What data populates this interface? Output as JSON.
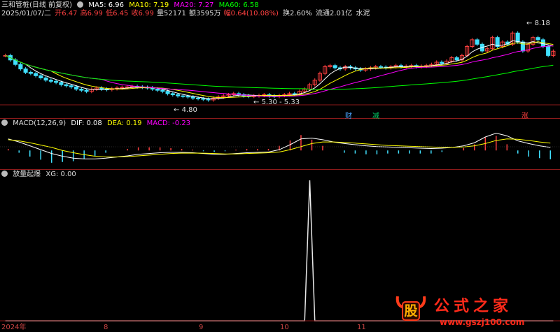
{
  "header1": {
    "stock_name": "三和管桩(日线 前复权)",
    "ma5": "MA5: 6.96",
    "ma10": "MA10: 7.19",
    "ma20": "MA20: 7.27",
    "ma60": "MA60: 6.58",
    "colors": {
      "ma5": "#ffffff",
      "ma10": "#ffff00",
      "ma20": "#ff00ff",
      "ma60": "#00ff00"
    }
  },
  "header2": {
    "date": "2025/01/07/二",
    "open": "开6.47",
    "high": "高6.99",
    "low": "低6.45",
    "close": "收6.99",
    "volume": "量52171",
    "amount": "额3595万",
    "change": "幅0.64(10.08%)",
    "turnover": "换2.60%",
    "float_cap": "流通2.01亿",
    "sector": "水泥"
  },
  "price_labels": {
    "high_mark": "8.18",
    "low_mark": "4.80",
    "range_mark": "5.30 - 5.33"
  },
  "event_marks": [
    "财",
    "减",
    "涨"
  ],
  "macd_header": {
    "name": "MACD(12,26,9)",
    "dif": "DIF: 0.08",
    "dea": "DEA: 0.19",
    "macd": "MACD: -0.23"
  },
  "signal_header": {
    "name": "放量起爆",
    "xg": "XG: 0.00"
  },
  "x_axis": [
    "2024年",
    "8",
    "9",
    "10",
    "11"
  ],
  "watermark": {
    "logo_char": "股",
    "site_name": "公式之家",
    "url": "www.gszj100.com"
  },
  "chart_data": [
    {
      "type": "candlestick",
      "title": "三和管桩(日线 前复权)",
      "ylim": [
        4.6,
        8.4
      ],
      "close": [
        6.8,
        6.6,
        6.4,
        6.2,
        6.05,
        6.0,
        5.9,
        5.8,
        5.7,
        5.65,
        5.6,
        5.5,
        5.45,
        5.4,
        5.3,
        5.25,
        5.2,
        5.3,
        5.35,
        5.3,
        5.28,
        5.32,
        5.35,
        5.38,
        5.4,
        5.42,
        5.4,
        5.38,
        5.36,
        5.3,
        5.25,
        5.2,
        5.1,
        5.05,
        5.0,
        4.98,
        4.95,
        4.9,
        4.88,
        4.85,
        4.82,
        4.9,
        4.95,
        5.0,
        5.05,
        5.1,
        5.05,
        5.0,
        4.98,
        5.0,
        5.02,
        5.05,
        5.0,
        4.98,
        5.02,
        5.05,
        5.1,
        5.08,
        5.2,
        5.3,
        5.5,
        5.7,
        6.0,
        6.3,
        6.35,
        6.25,
        6.2,
        6.3,
        6.25,
        6.2,
        6.15,
        6.2,
        6.25,
        6.3,
        6.28,
        6.25,
        6.3,
        6.35,
        6.3,
        6.32,
        6.35,
        6.3,
        6.32,
        6.35,
        6.4,
        6.5,
        6.45,
        6.55,
        6.7,
        6.6,
        6.8,
        7.2,
        7.5,
        7.3,
        7.0,
        7.1,
        7.6,
        7.2,
        7.4,
        7.3,
        7.8,
        7.4,
        7.0,
        7.3,
        7.6,
        7.5,
        7.2,
        6.8,
        6.99
      ],
      "annotations": [
        "8.18",
        "4.80",
        "5.30 - 5.33"
      ]
    },
    {
      "type": "line",
      "title": "MACD(12,26,9)",
      "series": [
        {
          "name": "DIF",
          "values": [
            0.3,
            0.22,
            0.12,
            0.02,
            -0.08,
            -0.15,
            -0.2,
            -0.22,
            -0.22,
            -0.2,
            -0.17,
            -0.14,
            -0.1,
            -0.08,
            -0.06,
            -0.05,
            -0.05,
            -0.06,
            -0.08,
            -0.1,
            -0.1,
            -0.08,
            -0.06,
            -0.05,
            -0.04,
            0.02,
            0.15,
            0.3,
            0.32,
            0.28,
            0.22,
            0.18,
            0.15,
            0.12,
            0.1,
            0.09,
            0.08,
            0.07,
            0.06,
            0.05,
            0.06,
            0.08,
            0.12,
            0.2,
            0.35,
            0.45,
            0.38,
            0.25,
            0.18,
            0.12,
            0.08
          ]
        },
        {
          "name": "DEA",
          "values": [
            0.28,
            0.25,
            0.2,
            0.14,
            0.08,
            0.0,
            -0.06,
            -0.11,
            -0.15,
            -0.17,
            -0.17,
            -0.16,
            -0.14,
            -0.12,
            -0.1,
            -0.08,
            -0.07,
            -0.07,
            -0.07,
            -0.08,
            -0.09,
            -0.09,
            -0.08,
            -0.07,
            -0.06,
            -0.04,
            0.02,
            0.1,
            0.18,
            0.22,
            0.22,
            0.21,
            0.19,
            0.17,
            0.15,
            0.13,
            0.12,
            0.11,
            0.1,
            0.09,
            0.08,
            0.08,
            0.09,
            0.12,
            0.18,
            0.26,
            0.3,
            0.29,
            0.26,
            0.22,
            0.19
          ]
        },
        {
          "name": "MACD",
          "values": [
            0.04,
            -0.06,
            -0.16,
            -0.24,
            -0.32,
            -0.3,
            -0.28,
            -0.22,
            -0.14,
            -0.06,
            0.0,
            0.04,
            0.08,
            0.08,
            0.08,
            0.06,
            0.04,
            0.02,
            -0.02,
            -0.04,
            -0.02,
            0.02,
            0.04,
            0.04,
            0.04,
            0.12,
            0.26,
            0.4,
            0.28,
            0.12,
            0.0,
            -0.06,
            -0.08,
            -0.1,
            -0.1,
            -0.08,
            -0.08,
            -0.08,
            -0.08,
            -0.08,
            -0.04,
            0.0,
            0.06,
            0.16,
            0.34,
            0.38,
            0.16,
            -0.08,
            -0.16,
            -0.2,
            -0.23
          ]
        }
      ],
      "ylim": [
        -0.45,
        0.55
      ]
    },
    {
      "type": "line",
      "title": "放量起爆",
      "series": [
        {
          "name": "XG",
          "values": [
            0,
            0,
            0,
            0,
            0,
            0,
            0,
            0,
            0,
            0,
            0,
            0,
            0,
            0,
            0,
            0,
            0,
            0,
            0,
            0,
            0,
            0,
            0,
            0,
            0,
            0,
            0,
            0,
            0,
            0,
            0,
            0,
            0,
            0,
            0,
            0,
            0,
            0,
            0,
            0,
            0,
            0,
            0,
            0,
            0,
            0,
            0,
            0,
            0,
            0,
            0,
            0,
            0,
            0,
            0,
            0,
            0,
            0,
            0,
            0,
            1,
            0,
            0,
            0,
            0,
            0,
            0,
            0,
            0,
            0,
            0,
            0,
            0,
            0,
            0,
            0,
            0,
            0,
            0,
            0,
            0,
            0,
            0,
            0,
            0,
            0,
            0,
            0,
            0,
            0,
            0,
            0,
            0,
            0,
            0,
            0,
            0,
            0,
            0,
            0,
            0,
            0,
            0,
            0,
            0,
            0,
            0,
            0,
            0
          ]
        }
      ],
      "ylim": [
        0,
        1
      ]
    }
  ]
}
